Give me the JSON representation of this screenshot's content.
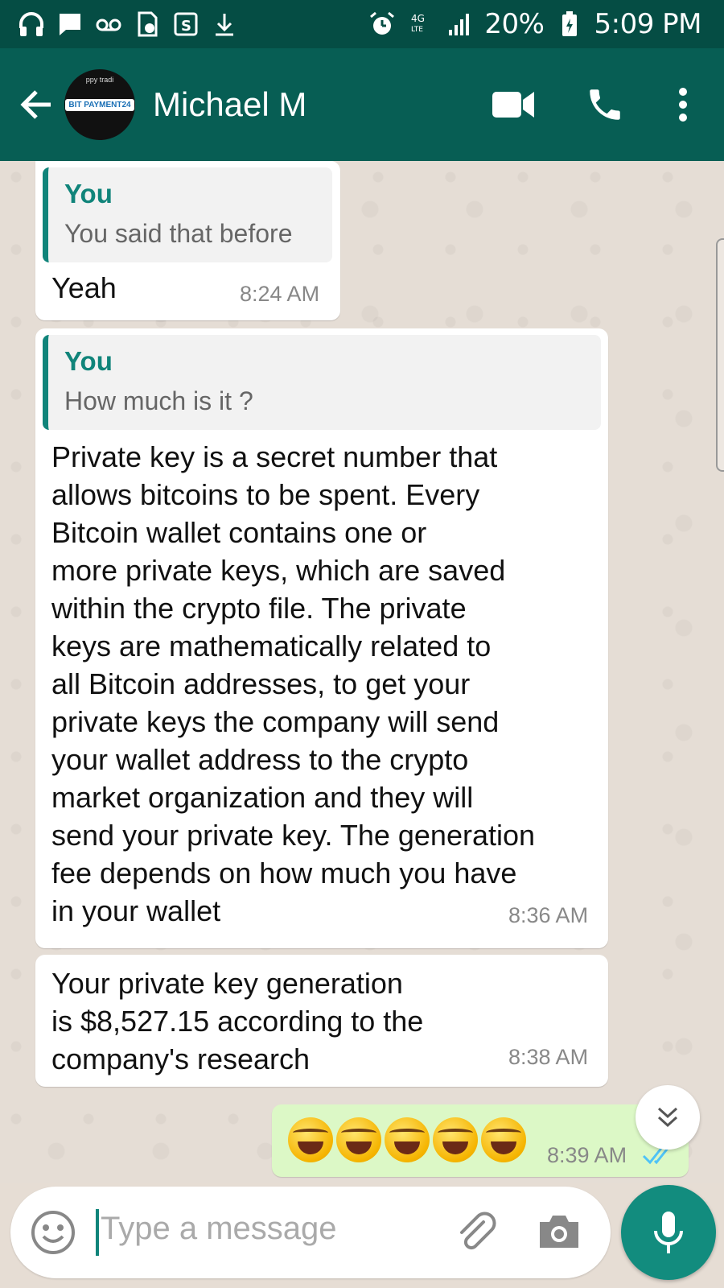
{
  "status_bar": {
    "icons_left": [
      "headset-icon",
      "chat-icon",
      "voicemail-icon",
      "sim-icon",
      "samsung-pay-icon",
      "download-icon"
    ],
    "icons_right": [
      "alarm-icon",
      "4g-lte-icon",
      "signal-icon",
      "battery-charging-icon"
    ],
    "battery": "20%",
    "time": "5:09 PM"
  },
  "app_bar": {
    "contact_name": "Michael M",
    "avatar_top_text": "ppy tradi",
    "avatar_logo_text": "BIT PAYMENT24"
  },
  "messages": [
    {
      "quote_author": "You",
      "quote_text": "You said that before",
      "text": "Yeah",
      "time": "8:24 AM"
    },
    {
      "quote_author": "You",
      "quote_text": "How much is it ?",
      "lines": [
        "Private key is a secret number that",
        "allows bitcoins to be spent. Every",
        "Bitcoin wallet contains one or",
        "more private keys, which are saved",
        "within the crypto file. The private",
        "keys are mathematically related to",
        "all Bitcoin addresses, to get your",
        "private keys the company will send",
        "your wallet address to the crypto",
        "market organization and they will",
        "send your private key. The generation",
        "fee depends on how much you have",
        "in your wallet"
      ],
      "time": "8:36 AM"
    },
    {
      "lines": [
        "Your private key generation",
        "is $8,527.15 according to the",
        "company's research"
      ],
      "time": "8:38 AM"
    },
    {
      "emojis": [
        "rolling-on-floor-laughing",
        "rolling-on-floor-laughing",
        "rolling-on-floor-laughing",
        "rolling-on-floor-laughing",
        "rolling-on-floor-laughing"
      ],
      "time": "8:39 AM",
      "status": "read-double-check"
    }
  ],
  "input": {
    "placeholder": "Type a message"
  },
  "colors": {
    "status_bar": "#054d44",
    "app_bar": "#075e54",
    "accent": "#10847a",
    "outgoing_bubble": "#dcf8c6",
    "read_ticks": "#4fc3f7"
  }
}
